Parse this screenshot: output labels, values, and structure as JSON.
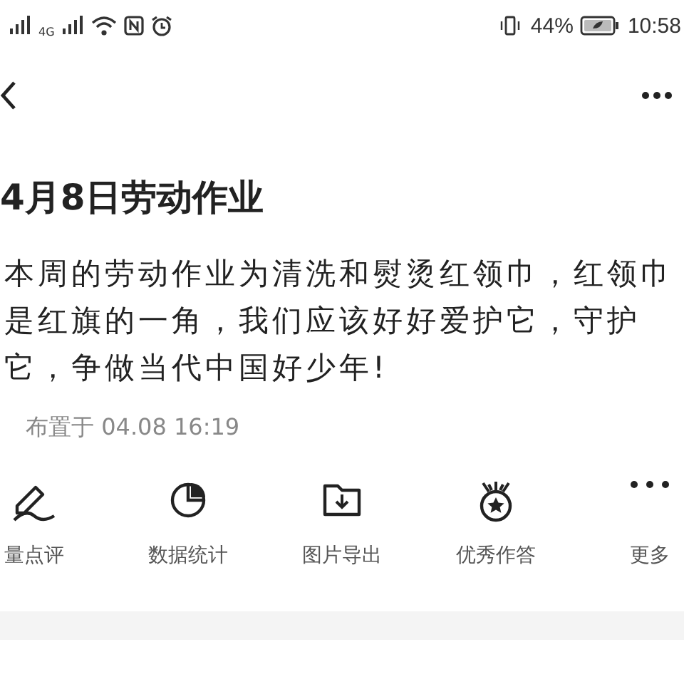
{
  "status_bar": {
    "network_label": "4G",
    "battery_percent": "44%",
    "time": "10:58"
  },
  "post": {
    "title": "4月8日劳动作业",
    "body_lines": [
      "本周的劳动作业为清洗和熨烫红领巾，红领巾",
      "是红旗的一角，我们应该好好爱护它，守护",
      "它，争做当代中国好少年!"
    ],
    "meta": "布置于 04.08 16:19"
  },
  "actions": [
    {
      "kind": "pen",
      "label": "量点评"
    },
    {
      "kind": "pie",
      "label": "数据统计"
    },
    {
      "kind": "folder",
      "label": "图片导出"
    },
    {
      "kind": "medal",
      "label": "优秀作答"
    },
    {
      "kind": "more",
      "label": "更多"
    }
  ]
}
